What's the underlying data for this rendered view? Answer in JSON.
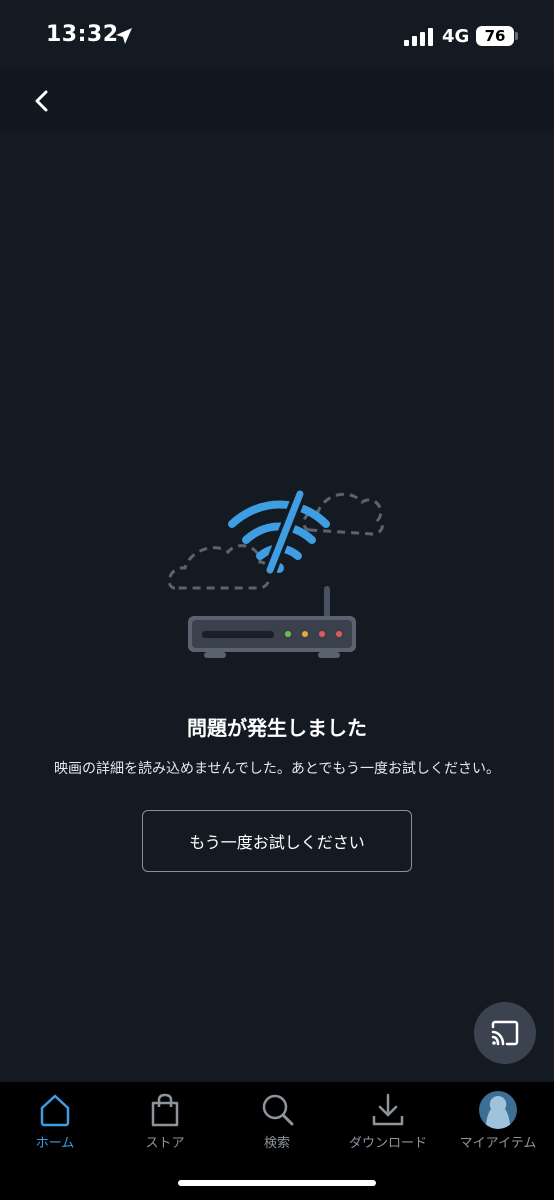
{
  "status_bar": {
    "time": "13:32",
    "network": "4G",
    "battery": "76",
    "icons": [
      "location-arrow-icon",
      "signal-icon",
      "battery-icon"
    ]
  },
  "nav": {
    "back_icon": "chevron-left-icon"
  },
  "error": {
    "illustration_icon": "no-wifi-router-icon",
    "title": "問題が発生しました",
    "message": "映画の詳細を読み込めませんでした。あとでもう一度お試しください。",
    "retry_label": "もう一度お試しください"
  },
  "cast": {
    "icon": "cast-icon"
  },
  "tabs": [
    {
      "label": "ホーム",
      "icon": "home-icon",
      "active": true
    },
    {
      "label": "ストア",
      "icon": "shopping-bag-icon",
      "active": false
    },
    {
      "label": "検索",
      "icon": "search-icon",
      "active": false
    },
    {
      "label": "ダウンロード",
      "icon": "download-icon",
      "active": false
    },
    {
      "label": "マイアイテム",
      "icon": "avatar-icon",
      "active": false
    }
  ],
  "colors": {
    "background": "#141a22",
    "accent": "#3f9de2",
    "tab_bar": "#000000",
    "tab_inactive": "#8d949c"
  }
}
